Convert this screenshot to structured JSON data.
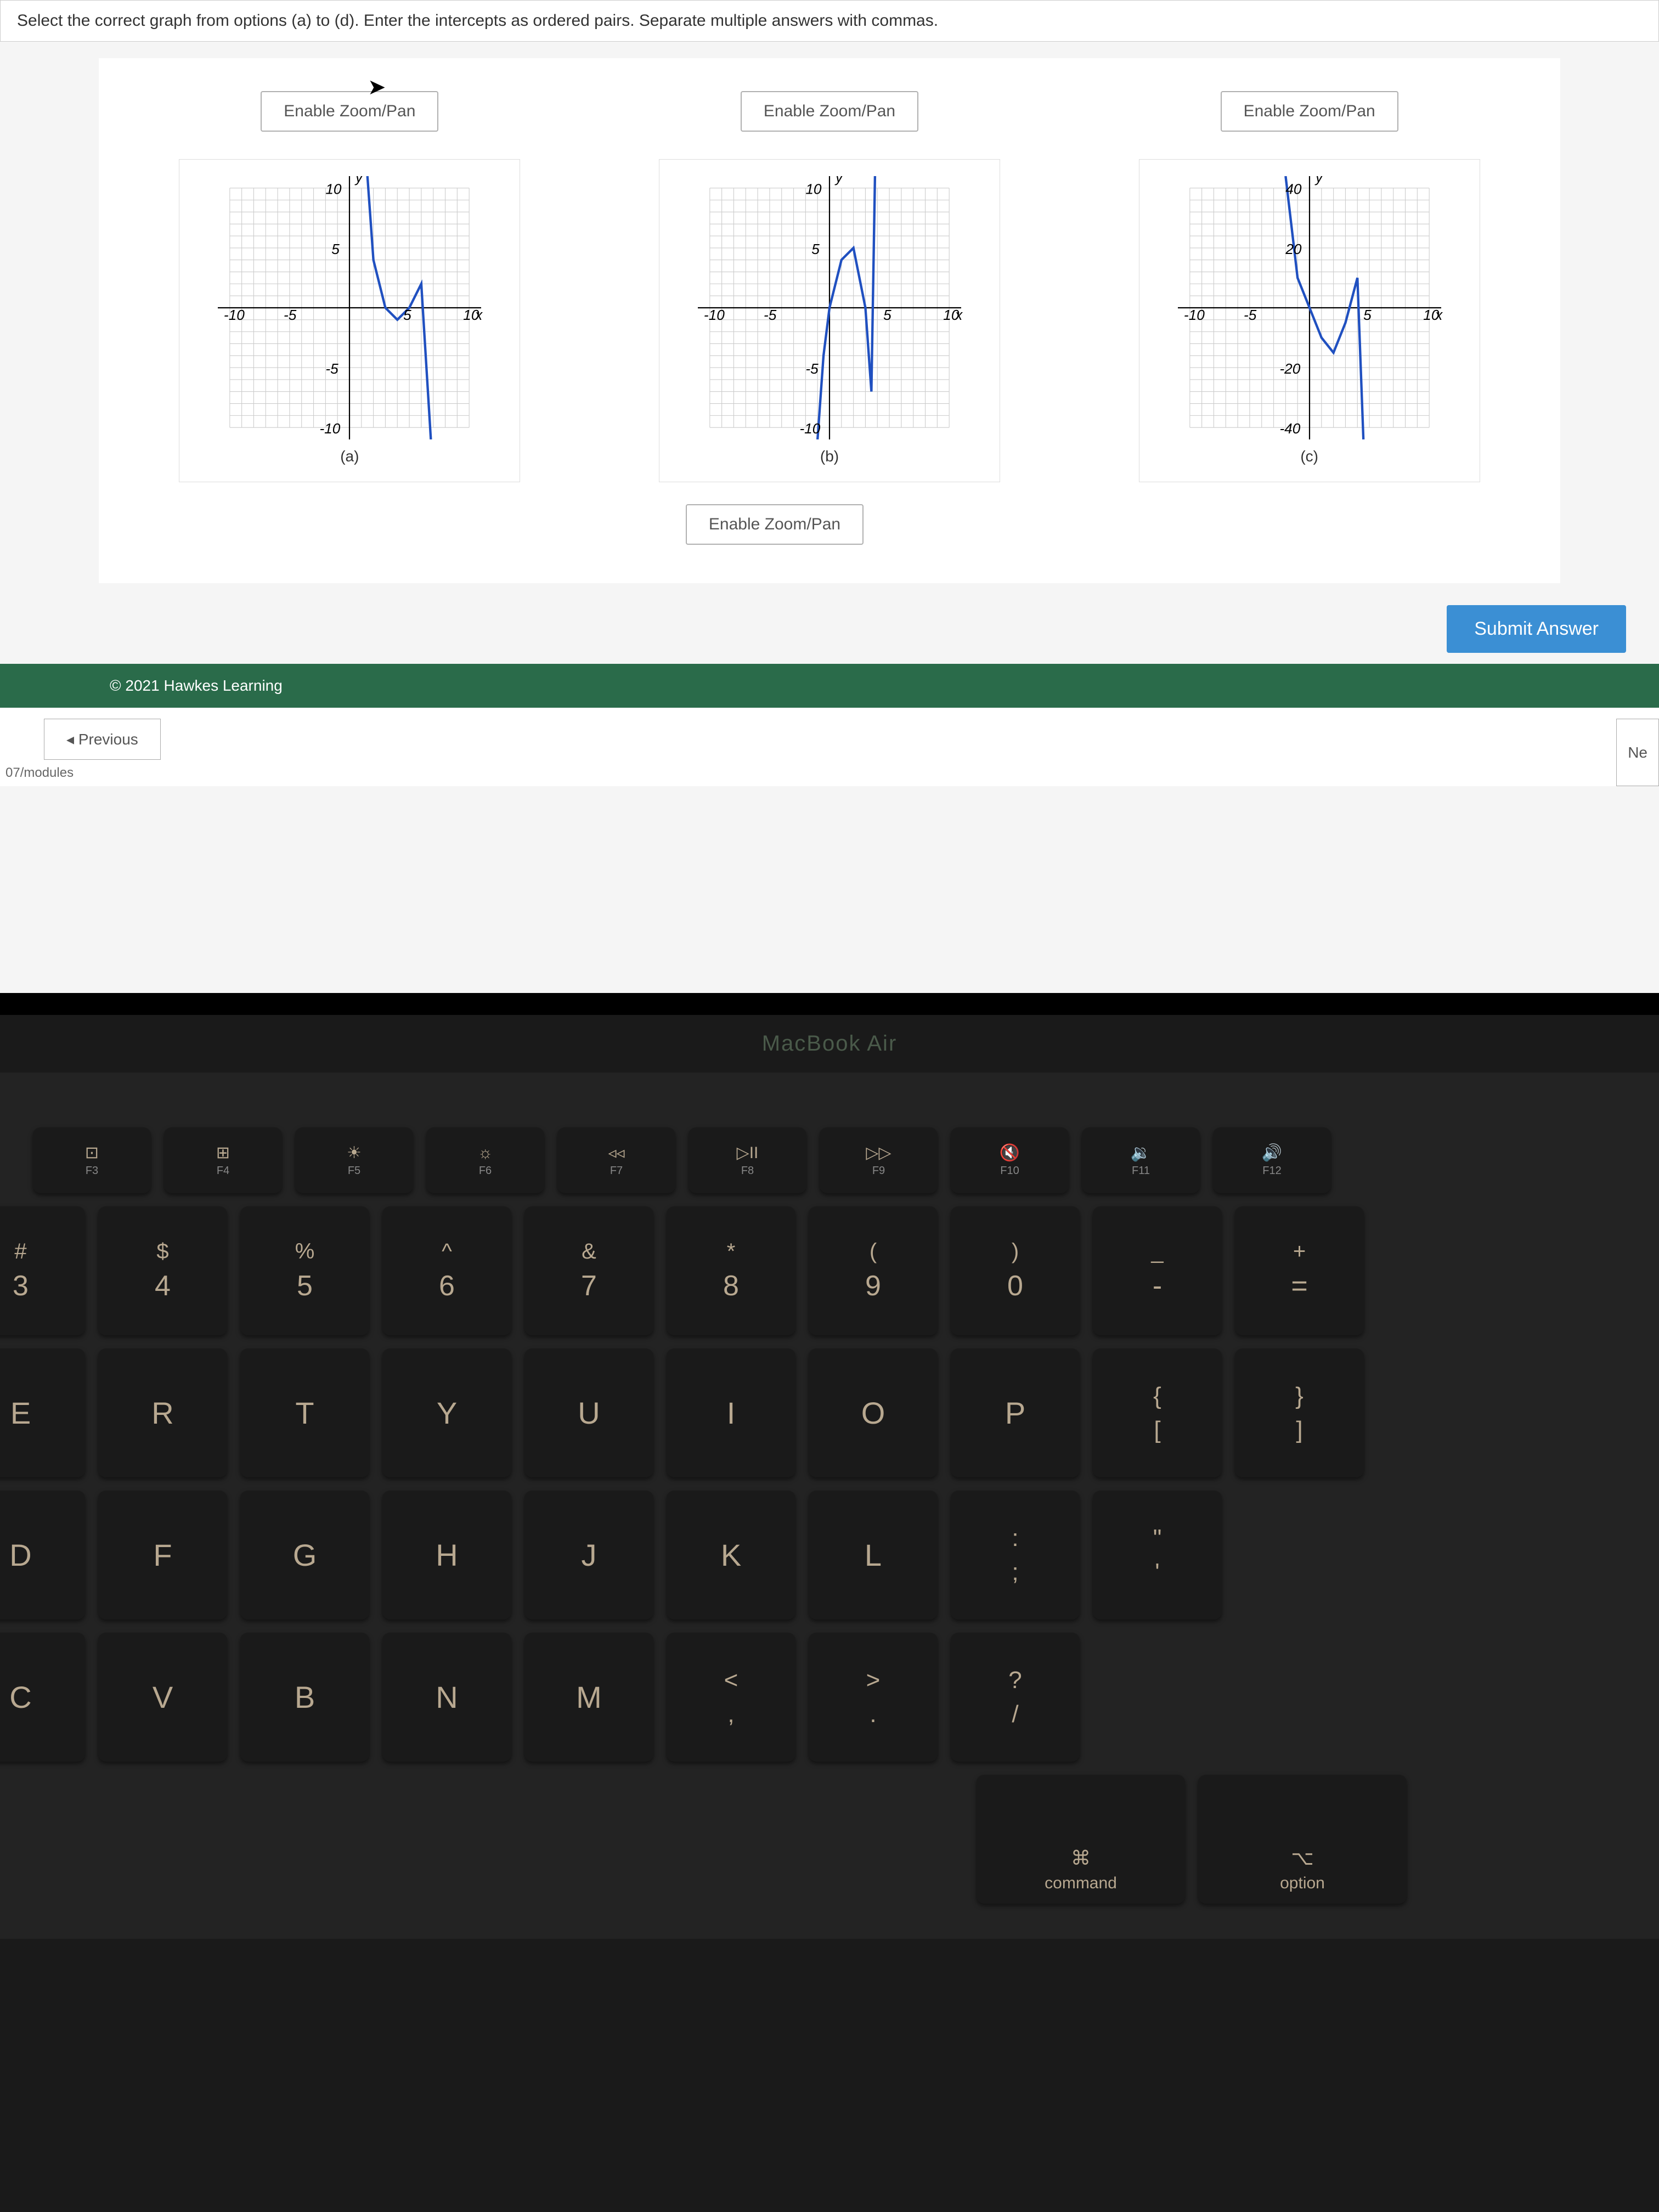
{
  "instruction": "Select the correct graph from options (a) to (d). Enter the intercepts as ordered pairs. Separate multiple answers with commas.",
  "zoom_label": "Enable Zoom/Pan",
  "graphs": {
    "a": {
      "label": "(a)",
      "x_label": "x",
      "y_label": "y",
      "x_ticks": [
        "-10",
        "-5",
        "5",
        "10"
      ],
      "y_ticks": [
        "-10",
        "-5",
        "5",
        "10"
      ]
    },
    "b": {
      "label": "(b)",
      "x_label": "x",
      "y_label": "y",
      "x_ticks": [
        "-10",
        "-5",
        "5",
        "10"
      ],
      "y_ticks": [
        "-10",
        "-5",
        "5",
        "10"
      ]
    },
    "c": {
      "label": "(c)",
      "x_label": "x",
      "y_label": "y",
      "x_ticks": [
        "-10",
        "-5",
        "5",
        "10"
      ],
      "y_ticks": [
        "-40",
        "-20",
        "20",
        "40"
      ]
    }
  },
  "chart_data": [
    {
      "id": "a",
      "type": "line",
      "xlim": [
        -11,
        11
      ],
      "ylim": [
        -11,
        11
      ],
      "x_ticks": [
        -10,
        -5,
        5,
        10
      ],
      "y_ticks": [
        -10,
        -5,
        5,
        10
      ],
      "curve_points": [
        [
          1.5,
          11
        ],
        [
          2,
          4
        ],
        [
          3,
          0
        ],
        [
          4,
          -1
        ],
        [
          5,
          0
        ],
        [
          6,
          2
        ],
        [
          6.8,
          -11
        ]
      ]
    },
    {
      "id": "b",
      "type": "line",
      "xlim": [
        -11,
        11
      ],
      "ylim": [
        -11,
        11
      ],
      "x_ticks": [
        -10,
        -5,
        5,
        10
      ],
      "y_ticks": [
        -10,
        -5,
        5,
        10
      ],
      "curve_points": [
        [
          -1,
          -11
        ],
        [
          -0.5,
          -4
        ],
        [
          0,
          0
        ],
        [
          1,
          4
        ],
        [
          2,
          5
        ],
        [
          3,
          0
        ],
        [
          3.5,
          -7
        ],
        [
          3.8,
          11
        ]
      ]
    },
    {
      "id": "c",
      "type": "line",
      "xlim": [
        -11,
        11
      ],
      "ylim": [
        -44,
        44
      ],
      "x_ticks": [
        -10,
        -5,
        5,
        10
      ],
      "y_ticks": [
        -40,
        -20,
        20,
        40
      ],
      "curve_points": [
        [
          -2,
          44
        ],
        [
          -1,
          10
        ],
        [
          0,
          0
        ],
        [
          1,
          -10
        ],
        [
          2,
          -15
        ],
        [
          3,
          -5
        ],
        [
          4,
          10
        ],
        [
          4.5,
          -44
        ]
      ]
    }
  ],
  "submit_label": "Submit Answer",
  "copyright": "© 2021 Hawkes Learning",
  "nav": {
    "previous": "◂ Previous",
    "next": "Ne",
    "path": "07/modules"
  },
  "laptop": "MacBook Air",
  "keyboard": {
    "fn_row": [
      {
        "icon": "⊡",
        "sub": "F3"
      },
      {
        "icon": "⊞",
        "sub": "F4"
      },
      {
        "icon": "☀",
        "sub": "F5"
      },
      {
        "icon": "☼",
        "sub": "F6"
      },
      {
        "icon": "◃◃",
        "sub": "F7"
      },
      {
        "icon": "▷II",
        "sub": "F8"
      },
      {
        "icon": "▷▷",
        "sub": "F9"
      },
      {
        "icon": "🔇",
        "sub": "F10"
      },
      {
        "icon": "🔉",
        "sub": "F11"
      },
      {
        "icon": "🔊",
        "sub": "F12"
      }
    ],
    "num_row": [
      {
        "top": "#",
        "bottom": "3"
      },
      {
        "top": "$",
        "bottom": "4"
      },
      {
        "top": "%",
        "bottom": "5"
      },
      {
        "top": "^",
        "bottom": "6"
      },
      {
        "top": "&",
        "bottom": "7"
      },
      {
        "top": "*",
        "bottom": "8"
      },
      {
        "top": "(",
        "bottom": "9"
      },
      {
        "top": ")",
        "bottom": "0"
      },
      {
        "top": "_",
        "bottom": "-"
      },
      {
        "top": "+",
        "bottom": "="
      }
    ],
    "row_q": [
      "E",
      "R",
      "T",
      "Y",
      "U",
      "I",
      "O",
      "P"
    ],
    "row_q_end": [
      {
        "top": "{",
        "bottom": "["
      },
      {
        "top": "}",
        "bottom": "]"
      }
    ],
    "row_a": [
      "D",
      "F",
      "G",
      "H",
      "J",
      "K",
      "L"
    ],
    "row_a_end": [
      {
        "top": ":",
        "bottom": ";"
      },
      {
        "top": "\"",
        "bottom": "'"
      }
    ],
    "row_z": [
      "C",
      "V",
      "B",
      "N",
      "M"
    ],
    "row_z_end": [
      {
        "top": "<",
        "bottom": ","
      },
      {
        "top": ">",
        "bottom": "."
      },
      {
        "top": "?",
        "bottom": "/"
      }
    ],
    "bottom_row": [
      {
        "icon": "⌘",
        "label": "command"
      },
      {
        "icon": "⌥",
        "label": "option"
      }
    ]
  }
}
